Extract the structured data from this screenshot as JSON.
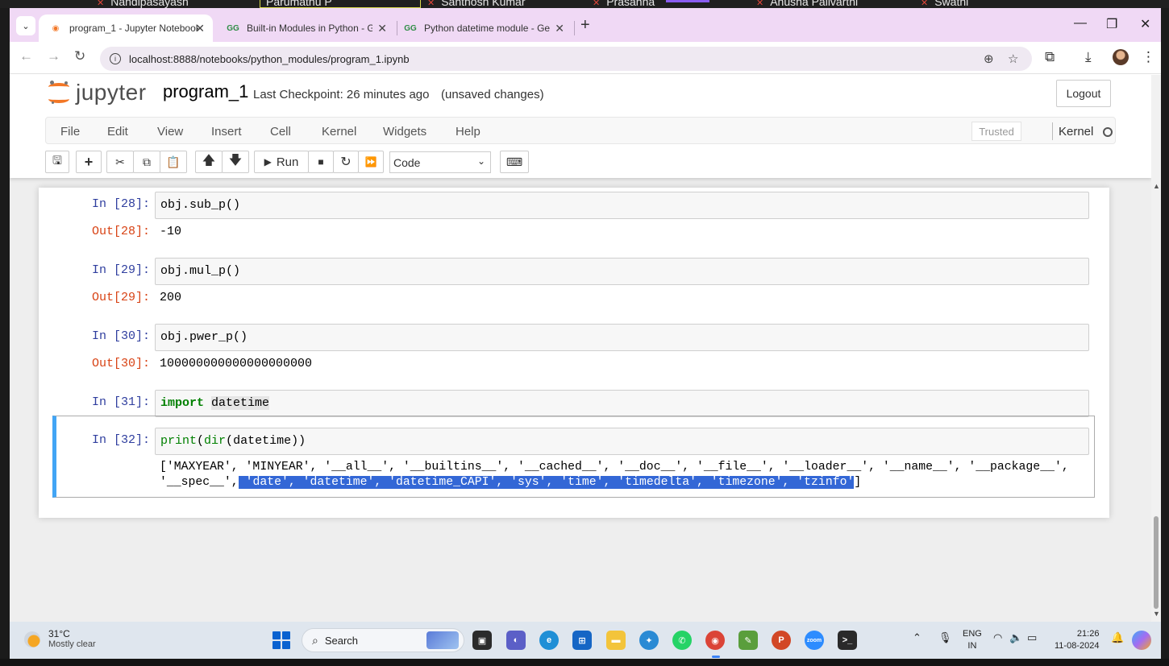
{
  "meeting_strip": {
    "participants": [
      "Nandipasayash",
      "Parumathu P",
      "Santhosh Kumar",
      "Prasanna",
      "Anusha Pallvarthi",
      "Swathi"
    ]
  },
  "browser": {
    "tabs": [
      {
        "title": "program_1 - Jupyter Notebook",
        "favicon": "jupyter-icon",
        "active": true
      },
      {
        "title": "Built-in Modules in Python - Ge",
        "favicon": "gfg-icon",
        "active": false
      },
      {
        "title": "Python datetime module - Geel",
        "favicon": "gfg-icon",
        "active": false
      }
    ],
    "url": "localhost:8888/notebooks/python_modules/program_1.ipynb"
  },
  "jupyter": {
    "logo_text": "jupyter",
    "notebook_name": "program_1",
    "checkpoint": "Last Checkpoint: 26 minutes ago",
    "unsaved": "(unsaved changes)",
    "logout": "Logout",
    "menu": [
      "File",
      "Edit",
      "View",
      "Insert",
      "Cell",
      "Kernel",
      "Widgets",
      "Help"
    ],
    "trusted": "Trusted",
    "kernel_label": "Kernel",
    "toolbar": {
      "run_label": "Run",
      "cell_type": "Code"
    }
  },
  "cells": [
    {
      "in_prompt": "In [28]:",
      "code": "obj.sub_p()",
      "out_prompt": "Out[28]:",
      "output": "-10"
    },
    {
      "in_prompt": "In [29]:",
      "code": "obj.mul_p()",
      "out_prompt": "Out[29]:",
      "output": "200"
    },
    {
      "in_prompt": "In [30]:",
      "code": "obj.pwer_p()",
      "out_prompt": "Out[30]:",
      "output": "100000000000000000000"
    },
    {
      "in_prompt": "In [31]:",
      "code_keyword": "import",
      "code_rest": "datetime"
    },
    {
      "in_prompt": "In [32]:",
      "code_builtin1": "print",
      "code_builtin2": "dir",
      "code_arg": "datetime",
      "output_line1": "['MAXYEAR', 'MINYEAR', '__all__', '__builtins__', '__cached__', '__doc__', '__file__', '__loader__', '__name__', '__package__',",
      "output_line2_plain": "'__spec__',",
      "output_line2_selected": " 'date', 'datetime', 'datetime_CAPI', 'sys', 'time', 'timedelta', 'timezone', 'tzinfo'",
      "output_line2_end": "]"
    }
  ],
  "taskbar": {
    "temperature": "31°C",
    "weather": "Mostly clear",
    "search_label": "Search",
    "lang_line1": "ENG",
    "lang_line2": "IN",
    "time": "21:26",
    "date": "11-08-2024"
  }
}
